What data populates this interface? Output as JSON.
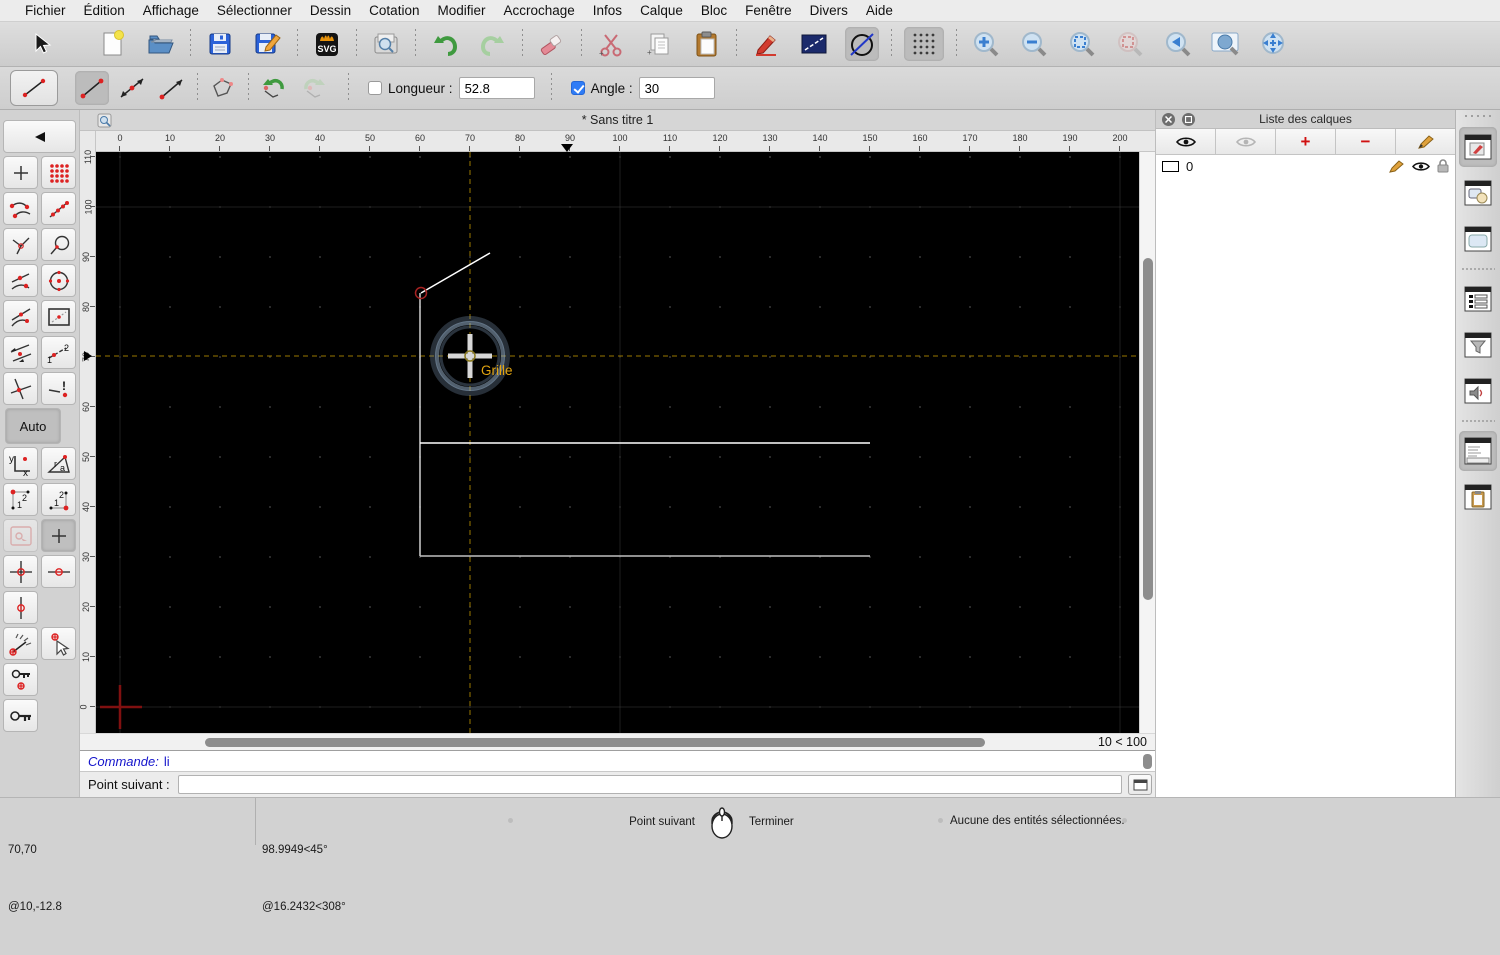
{
  "menu": {
    "items": [
      "Fichier",
      "Édition",
      "Affichage",
      "Sélectionner",
      "Dessin",
      "Cotation",
      "Modifier",
      "Accrochage",
      "Infos",
      "Calque",
      "Bloc",
      "Fenêtre",
      "Divers",
      "Aide"
    ]
  },
  "window": {
    "tab_title": "* Sans titre 1"
  },
  "toolbar": {
    "svg_badge": "SVG",
    "icons": [
      "selection-arrow",
      "new-document",
      "open-file",
      "save",
      "save-as",
      "svg-export",
      "print-preview",
      "undo",
      "redo",
      "delete-entities",
      "cut",
      "copy",
      "paste",
      "draw-pen",
      "edit-line-attributes",
      "draft-circle",
      "toggle-grid",
      "zoom-in",
      "zoom-out",
      "zoom-auto",
      "zoom-selection",
      "zoom-previous",
      "zoom-window",
      "zoom-pan"
    ]
  },
  "tool_options": {
    "length_label": "Longueur :",
    "length_value": "52.8",
    "length_checked": false,
    "angle_label": "Angle :",
    "angle_value": "30",
    "angle_checked": true,
    "icons": [
      "current-tool-line",
      "line-two-points",
      "line-angle",
      "line-arrow",
      "polygon",
      "undo-segment",
      "redo-segment"
    ]
  },
  "snap_sidebar": {
    "auto_label": "Auto",
    "icons": [
      "back",
      "snap-free",
      "snap-grid",
      "snap-endpoints",
      "snap-on-entity",
      "snap-perpendicular",
      "snap-tangent",
      "snap-middle",
      "snap-center",
      "snap-nearest",
      "snap-restriction",
      "snap-parallel",
      "snap-distance",
      "snap-intersection",
      "snap-intersection-manual",
      "coordinates-cartesian",
      "coordinates-polar",
      "ordinate-corner-1",
      "ordinate-corner-2",
      "restrict-off",
      "crosshair-free",
      "crosshair-point",
      "crosshair-horizontal",
      "crosshair-vertical",
      "angle-gauge",
      "select-point",
      "lock-relative-zero",
      "relative-zero"
    ]
  },
  "rulers": {
    "top": [
      "0",
      "10",
      "20",
      "30",
      "40",
      "50",
      "60",
      "70",
      "80",
      "90",
      "100",
      "110",
      "120",
      "130",
      "140",
      "150",
      "160",
      "170",
      "180",
      "190",
      "200"
    ],
    "left": [
      "110",
      "100",
      "90",
      "80",
      "70",
      "60",
      "50",
      "40",
      "30",
      "20",
      "10",
      "0"
    ]
  },
  "canvas": {
    "snap_label": "Grille",
    "grid_scale": "10 < 100"
  },
  "layers_panel": {
    "title": "Liste des calques",
    "buttons": [
      "show-all-layers",
      "hide-all-layers",
      "add-layer",
      "remove-layer",
      "edit-layer"
    ],
    "add_glyph": "+",
    "remove_glyph": "−",
    "layers": [
      {
        "name": "0"
      }
    ]
  },
  "dock_right": {
    "icons": [
      "layer-list",
      "block-list",
      "library-browser",
      "entity-list",
      "filter",
      "command-echo",
      "command-window",
      "clipboard"
    ]
  },
  "command_line": {
    "prompt": "Commande:",
    "value": "li"
  },
  "prompt_row": {
    "label": "Point suivant :",
    "value": ""
  },
  "status_bar": {
    "abs_coords": "70,70",
    "rel_coords": "@10,-12.8",
    "polar_abs": "98.9949<45°",
    "polar_rel": "@16.2432<308°",
    "left_click_hint": "Point suivant",
    "right_click_hint": "Terminer",
    "selection_info": "Aucune des entités sélectionnées."
  },
  "colors": {
    "canvas_bg": "#000000",
    "crosshair_orange": "#9a7800",
    "snap_label_orange": "#e2a410",
    "command_blue": "#1414cc",
    "checkbox_accent": "#2f7cf6",
    "layer_action_red": "#d01010",
    "origin_cross_red": "#801010"
  }
}
